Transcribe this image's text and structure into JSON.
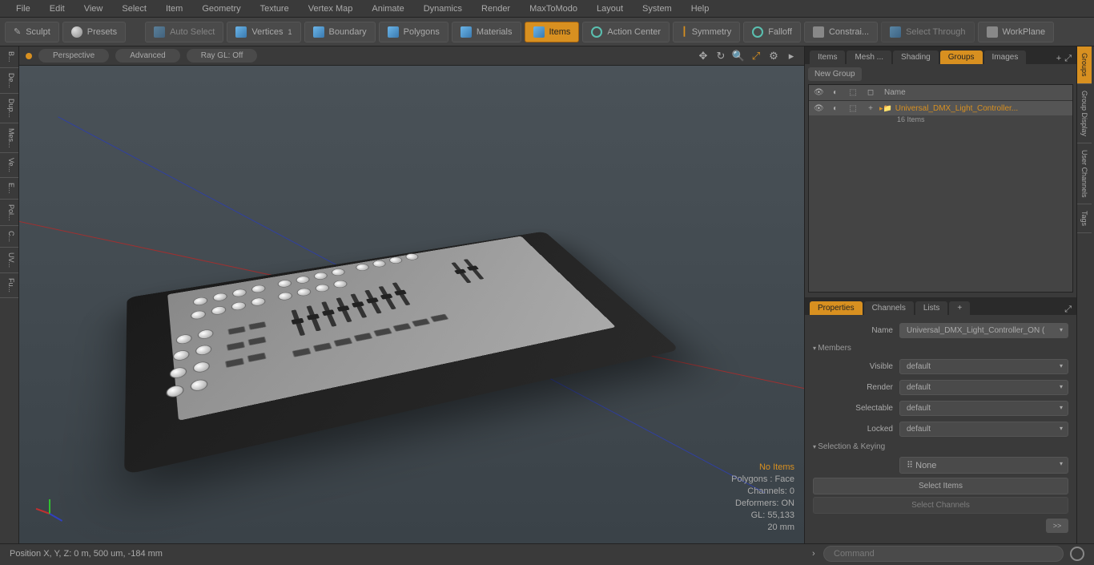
{
  "menu": {
    "items": [
      "File",
      "Edit",
      "View",
      "Select",
      "Item",
      "Geometry",
      "Texture",
      "Vertex Map",
      "Animate",
      "Dynamics",
      "Render",
      "MaxToModo",
      "Layout",
      "System",
      "Help"
    ]
  },
  "toolbar": {
    "sculpt": "Sculpt",
    "presets": "Presets",
    "autoselect": "Auto Select",
    "vertices": "Vertices",
    "boundary": "Boundary",
    "polygons": "Polygons",
    "materials": "Materials",
    "items": "Items",
    "actioncenter": "Action Center",
    "symmetry": "Symmetry",
    "falloff": "Falloff",
    "constrain": "Constrai...",
    "selectthrough": "Select Through",
    "workplane": "WorkPlane"
  },
  "leftbar": [
    "B...",
    "De...",
    "Dup...",
    "Mes...",
    "Ve...",
    "E...",
    "Pol...",
    "C...",
    "UV...",
    "Fu..."
  ],
  "viewport": {
    "tabs": [
      "Perspective",
      "Advanced",
      "Ray GL: Off"
    ],
    "overlay": {
      "noitems": "No Items",
      "polygons": "Polygons : Face",
      "channels": "Channels: 0",
      "deformers": "Deformers: ON",
      "gl": "GL: 55,133",
      "scale": "20 mm"
    }
  },
  "rightTabs": {
    "items": "Items",
    "mesh": "Mesh ...",
    "shading": "Shading",
    "groups": "Groups",
    "images": "Images"
  },
  "newgroup": "New Group",
  "listHeader": {
    "name": "Name"
  },
  "groupItem": {
    "name": "Universal_DMX_Light_Controller...",
    "count": "16 Items"
  },
  "propTabs": {
    "properties": "Properties",
    "channels": "Channels",
    "lists": "Lists"
  },
  "props": {
    "nameLabel": "Name",
    "nameValue": "Universal_DMX_Light_Controller_ON (",
    "members": "Members",
    "visible": {
      "label": "Visible",
      "value": "default"
    },
    "render": {
      "label": "Render",
      "value": "default"
    },
    "selectable": {
      "label": "Selectable",
      "value": "default"
    },
    "locked": {
      "label": "Locked",
      "value": "default"
    },
    "selkeying": "Selection & Keying",
    "none": "None",
    "selectItems": "Select Items",
    "selectChannels": "Select Channels",
    "go": ">>"
  },
  "rightside": [
    "Groups",
    "Group Display",
    "User Channels",
    "Tags"
  ],
  "status": {
    "pos": "Position X, Y, Z:   0 m, 500 um, -184 mm",
    "command": "Command"
  }
}
